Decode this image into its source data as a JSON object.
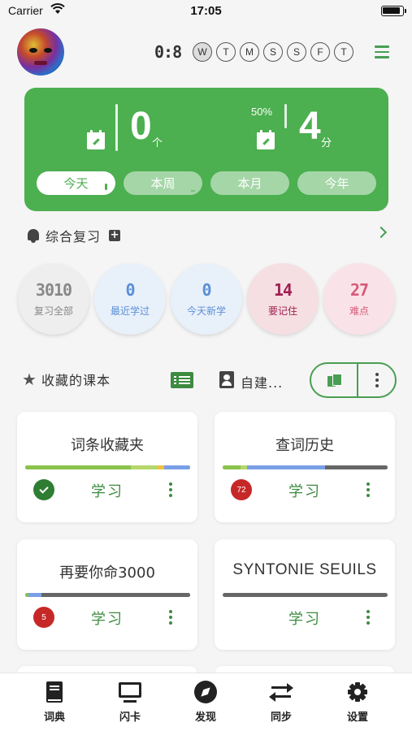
{
  "status_bar": {
    "carrier": "Carrier",
    "time": "17:05"
  },
  "header": {
    "counter": "0:8",
    "weekdays": [
      {
        "label": "W",
        "active": true
      },
      {
        "label": "T",
        "active": false
      },
      {
        "label": "M",
        "active": false
      },
      {
        "label": "S",
        "active": false
      },
      {
        "label": "S",
        "active": false
      },
      {
        "label": "F",
        "active": false
      },
      {
        "label": "T",
        "active": false
      }
    ]
  },
  "stats": {
    "words_value": "0",
    "words_unit": "个",
    "percent": "50%",
    "minutes_value": "4",
    "minutes_unit": "分",
    "periods": [
      "今天",
      "本周",
      "本月",
      "今年"
    ],
    "active_period": "今天"
  },
  "review": {
    "title": "综合复习",
    "categories": [
      {
        "count": "3010",
        "label": "复习全部",
        "color": "#888888",
        "bg": "#eeeeee"
      },
      {
        "count": "0",
        "label": "最近学过",
        "color": "#5b8fd6",
        "bg": "#e8f0fa"
      },
      {
        "count": "0",
        "label": "今天新学",
        "color": "#5b8fd6",
        "bg": "#e8f0fa"
      },
      {
        "count": "14",
        "label": "要记住",
        "color": "#9e2050",
        "bg": "#f5dfe3"
      },
      {
        "count": "27",
        "label": "难点",
        "color": "#d65a7a",
        "bg": "#f9e3e8"
      }
    ]
  },
  "favorites": {
    "title": "收藏的课本",
    "custom_label": "自建..."
  },
  "cards": [
    {
      "title": "词条收藏夹",
      "action": "学习",
      "badge": "check"
    },
    {
      "title": "查词历史",
      "action": "学习",
      "badge": "72"
    },
    {
      "title": "再要你命3000",
      "action": "学习",
      "badge": "5"
    },
    {
      "title": "SYNTONIE SEUILS",
      "action": "学习",
      "badge": ""
    }
  ],
  "colors": {
    "accent": "#4caf50",
    "dark_green": "#3d8b40",
    "badge_red": "#c62828"
  },
  "tabbar": [
    {
      "label": "词典",
      "icon": "book-icon"
    },
    {
      "label": "闪卡",
      "icon": "monitor-icon"
    },
    {
      "label": "发现",
      "icon": "compass-icon"
    },
    {
      "label": "同步",
      "icon": "sync-icon"
    },
    {
      "label": "设置",
      "icon": "gear-icon"
    }
  ]
}
